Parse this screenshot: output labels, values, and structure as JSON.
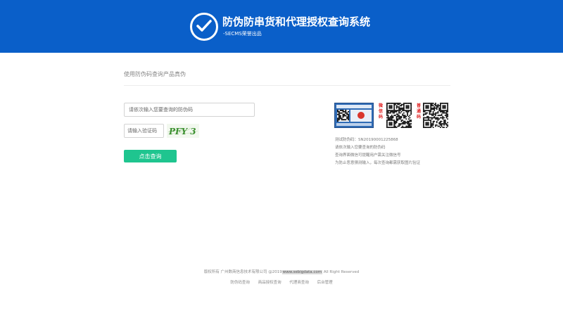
{
  "header": {
    "title": "防伪防串货和代理授权查询系统",
    "subtitle": "-SECMS荣誉出品",
    "logo_icon": "check-circle-icon",
    "background": "#0a5fc9"
  },
  "main": {
    "section_title": "使用防伪码查询产品真伪",
    "code_input": {
      "placeholder": "请依次输入您要查询的防伪码",
      "value": ""
    },
    "captcha_input": {
      "placeholder": "请输入验证码",
      "value": ""
    },
    "captcha_text": "PFY 3",
    "submit_label": "点击查询",
    "submit_color": "#1fc58f"
  },
  "sample": {
    "wechat_label": "微信码",
    "normal_label": "普通码",
    "lines": [
      "测试防伪码：SN20190001225868",
      "请依次输入您要查询的防伪码",
      "查询界面微信可提醒用户需关注微信号",
      "为防止恶意猜测输入，每次查询都需获取图片验证"
    ]
  },
  "footer": {
    "copyright_prefix": "版权所有 广州数商信息技术有限公司 @2019",
    "domain": "www.sebigdata.com",
    "copyright_suffix": "All Right Reserved",
    "links": [
      "防伪码查询",
      "商品授权查询",
      "代理商查询",
      "后台管理"
    ]
  }
}
